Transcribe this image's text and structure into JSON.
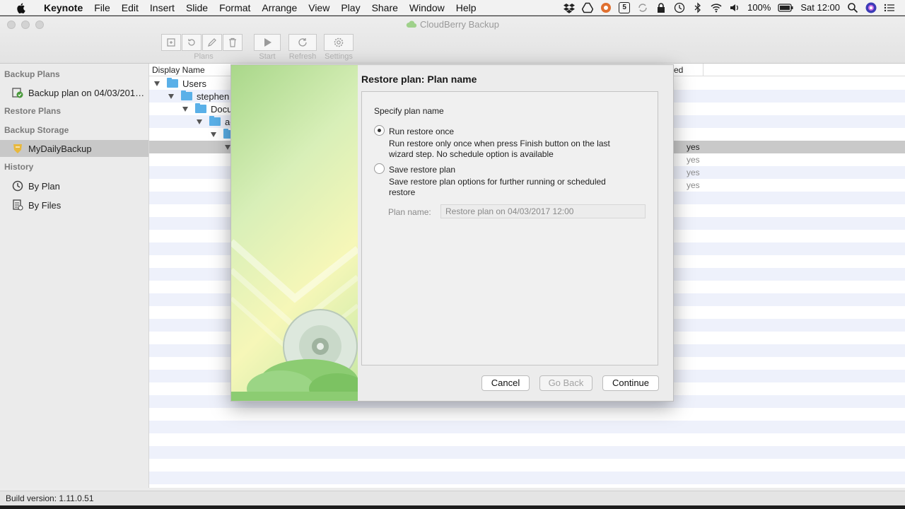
{
  "menubar": {
    "app_name": "Keynote",
    "items": [
      "File",
      "Edit",
      "Insert",
      "Slide",
      "Format",
      "Arrange",
      "View",
      "Play",
      "Share",
      "Window",
      "Help"
    ],
    "tray_badge": "5",
    "battery": "100%",
    "clock": "Sat 12:00"
  },
  "window": {
    "title": "CloudBerry Backup",
    "toolbar": {
      "plans_label": "Plans",
      "start_label": "Start",
      "refresh_label": "Refresh",
      "settings_label": "Settings"
    }
  },
  "sidebar": {
    "backup_plans_header": "Backup Plans",
    "backup_plan_item": "Backup plan on 04/03/201…",
    "restore_plans_header": "Restore Plans",
    "backup_storage_header": "Backup Storage",
    "storage_item": "MyDailyBackup",
    "history_header": "History",
    "history_by_plan": "By Plan",
    "history_by_files": "By Files"
  },
  "list": {
    "col_display_name": "Display Name",
    "col_partial": "ed",
    "tree": [
      {
        "label": "Users",
        "depth": 0
      },
      {
        "label": "stephen",
        "depth": 1
      },
      {
        "label": "Docu",
        "depth": 2
      },
      {
        "label": "ad",
        "depth": 3
      },
      {
        "label": "",
        "depth": 4
      },
      {
        "label": "",
        "depth": 5
      }
    ],
    "yes_values": [
      "yes",
      "yes",
      "yes",
      "yes"
    ]
  },
  "dialog": {
    "title": "Restore plan: Plan name",
    "section_label": "Specify plan name",
    "option_once_label": "Run restore once",
    "option_once_desc_1": "Run restore only once when press Finish button on the last",
    "option_once_desc_2": "wizard step. No schedule option is available",
    "option_save_label": "Save restore plan",
    "option_save_desc_1": "Save restore plan options for further running or scheduled",
    "option_save_desc_2": "restore",
    "plan_name_label": "Plan name:",
    "plan_name_value": "Restore plan on 04/03/2017 12:00",
    "cancel_label": "Cancel",
    "back_label": "Go Back",
    "continue_label": "Continue"
  },
  "statusbar": {
    "build": "Build version: 1.11.0.51"
  },
  "colors": {
    "row_alt": "#eef1fb",
    "row_selected": "#c9c9c9",
    "folder": "#5ab0e8",
    "accent_green": "#4a9a3c"
  }
}
